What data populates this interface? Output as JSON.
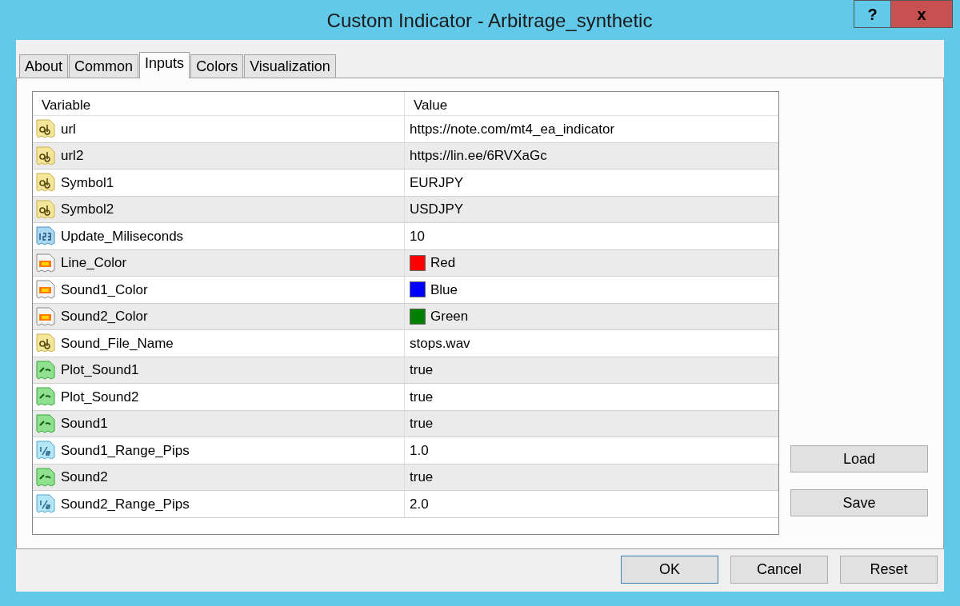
{
  "window": {
    "title": "Custom Indicator - Arbitrage_synthetic",
    "help": "?",
    "close": "x"
  },
  "tabs": [
    {
      "label": "About",
      "selected": false
    },
    {
      "label": "Common",
      "selected": false
    },
    {
      "label": "Inputs",
      "selected": true
    },
    {
      "label": "Colors",
      "selected": false
    },
    {
      "label": "Visualization",
      "selected": false
    }
  ],
  "table": {
    "columns": [
      "Variable",
      "Value"
    ],
    "rows": [
      {
        "kind": "string",
        "variable": "url",
        "value": "https://note.com/mt4_ea_indicator"
      },
      {
        "kind": "string",
        "variable": "url2",
        "value": "https://lin.ee/6RVXaGc"
      },
      {
        "kind": "string",
        "variable": "Symbol1",
        "value": "EURJPY"
      },
      {
        "kind": "string",
        "variable": "Symbol2",
        "value": "USDJPY"
      },
      {
        "kind": "integer",
        "variable": "Update_Miliseconds",
        "value": "10"
      },
      {
        "kind": "color",
        "variable": "Line_Color",
        "value": "Red",
        "color": "#ff0000"
      },
      {
        "kind": "color",
        "variable": "Sound1_Color",
        "value": "Blue",
        "color": "#0000ff"
      },
      {
        "kind": "color",
        "variable": "Sound2_Color",
        "value": "Green",
        "color": "#008000"
      },
      {
        "kind": "string",
        "variable": "Sound_File_Name",
        "value": "stops.wav"
      },
      {
        "kind": "bool",
        "variable": "Plot_Sound1",
        "value": "true"
      },
      {
        "kind": "bool",
        "variable": "Plot_Sound2",
        "value": "true"
      },
      {
        "kind": "bool",
        "variable": "Sound1",
        "value": "true"
      },
      {
        "kind": "double",
        "variable": "Sound1_Range_Pips",
        "value": "1.0"
      },
      {
        "kind": "bool",
        "variable": "Sound2",
        "value": "true"
      },
      {
        "kind": "double",
        "variable": "Sound2_Range_Pips",
        "value": "2.0"
      }
    ]
  },
  "side_buttons": [
    "Load",
    "Save"
  ],
  "buttons": [
    "OK",
    "Cancel",
    "Reset"
  ]
}
